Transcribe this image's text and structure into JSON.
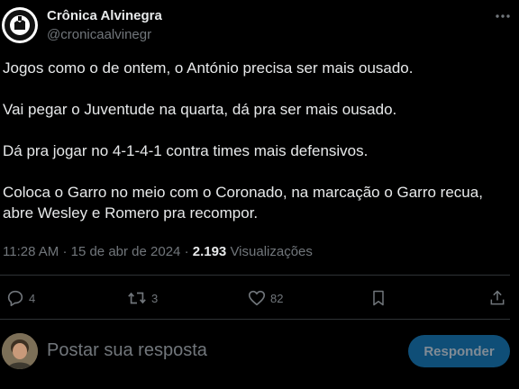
{
  "author": {
    "name": "Crônica Alvinegra",
    "handle": "@cronicaalvinegr",
    "avatar_text": "CRÔNICA ALVINEGRA"
  },
  "tweet": {
    "paragraphs": [
      "Jogos como o de ontem, o António precisa ser mais ousado.",
      "Vai pegar o Juventude na quarta, dá pra ser mais ousado.",
      "Dá pra jogar no 4-1-4-1 contra times mais defensivos.",
      "Coloca o Garro no meio com o Coronado, na marcação o Garro recua, abre Wesley e Romero pra recompor."
    ]
  },
  "meta": {
    "time": "11:28 AM",
    "separator": "·",
    "date": "15 de abr de 2024",
    "views_count": "2.193",
    "views_label": "Visualizações"
  },
  "actions": {
    "reply_count": "4",
    "retweet_count": "3",
    "like_count": "82"
  },
  "composer": {
    "placeholder": "Postar sua resposta",
    "reply_button": "Responder"
  },
  "colors": {
    "background": "#000000",
    "text": "#e7e9ea",
    "muted": "#71767b",
    "divider": "#2f3336",
    "button_bg": "#0f4e77"
  }
}
